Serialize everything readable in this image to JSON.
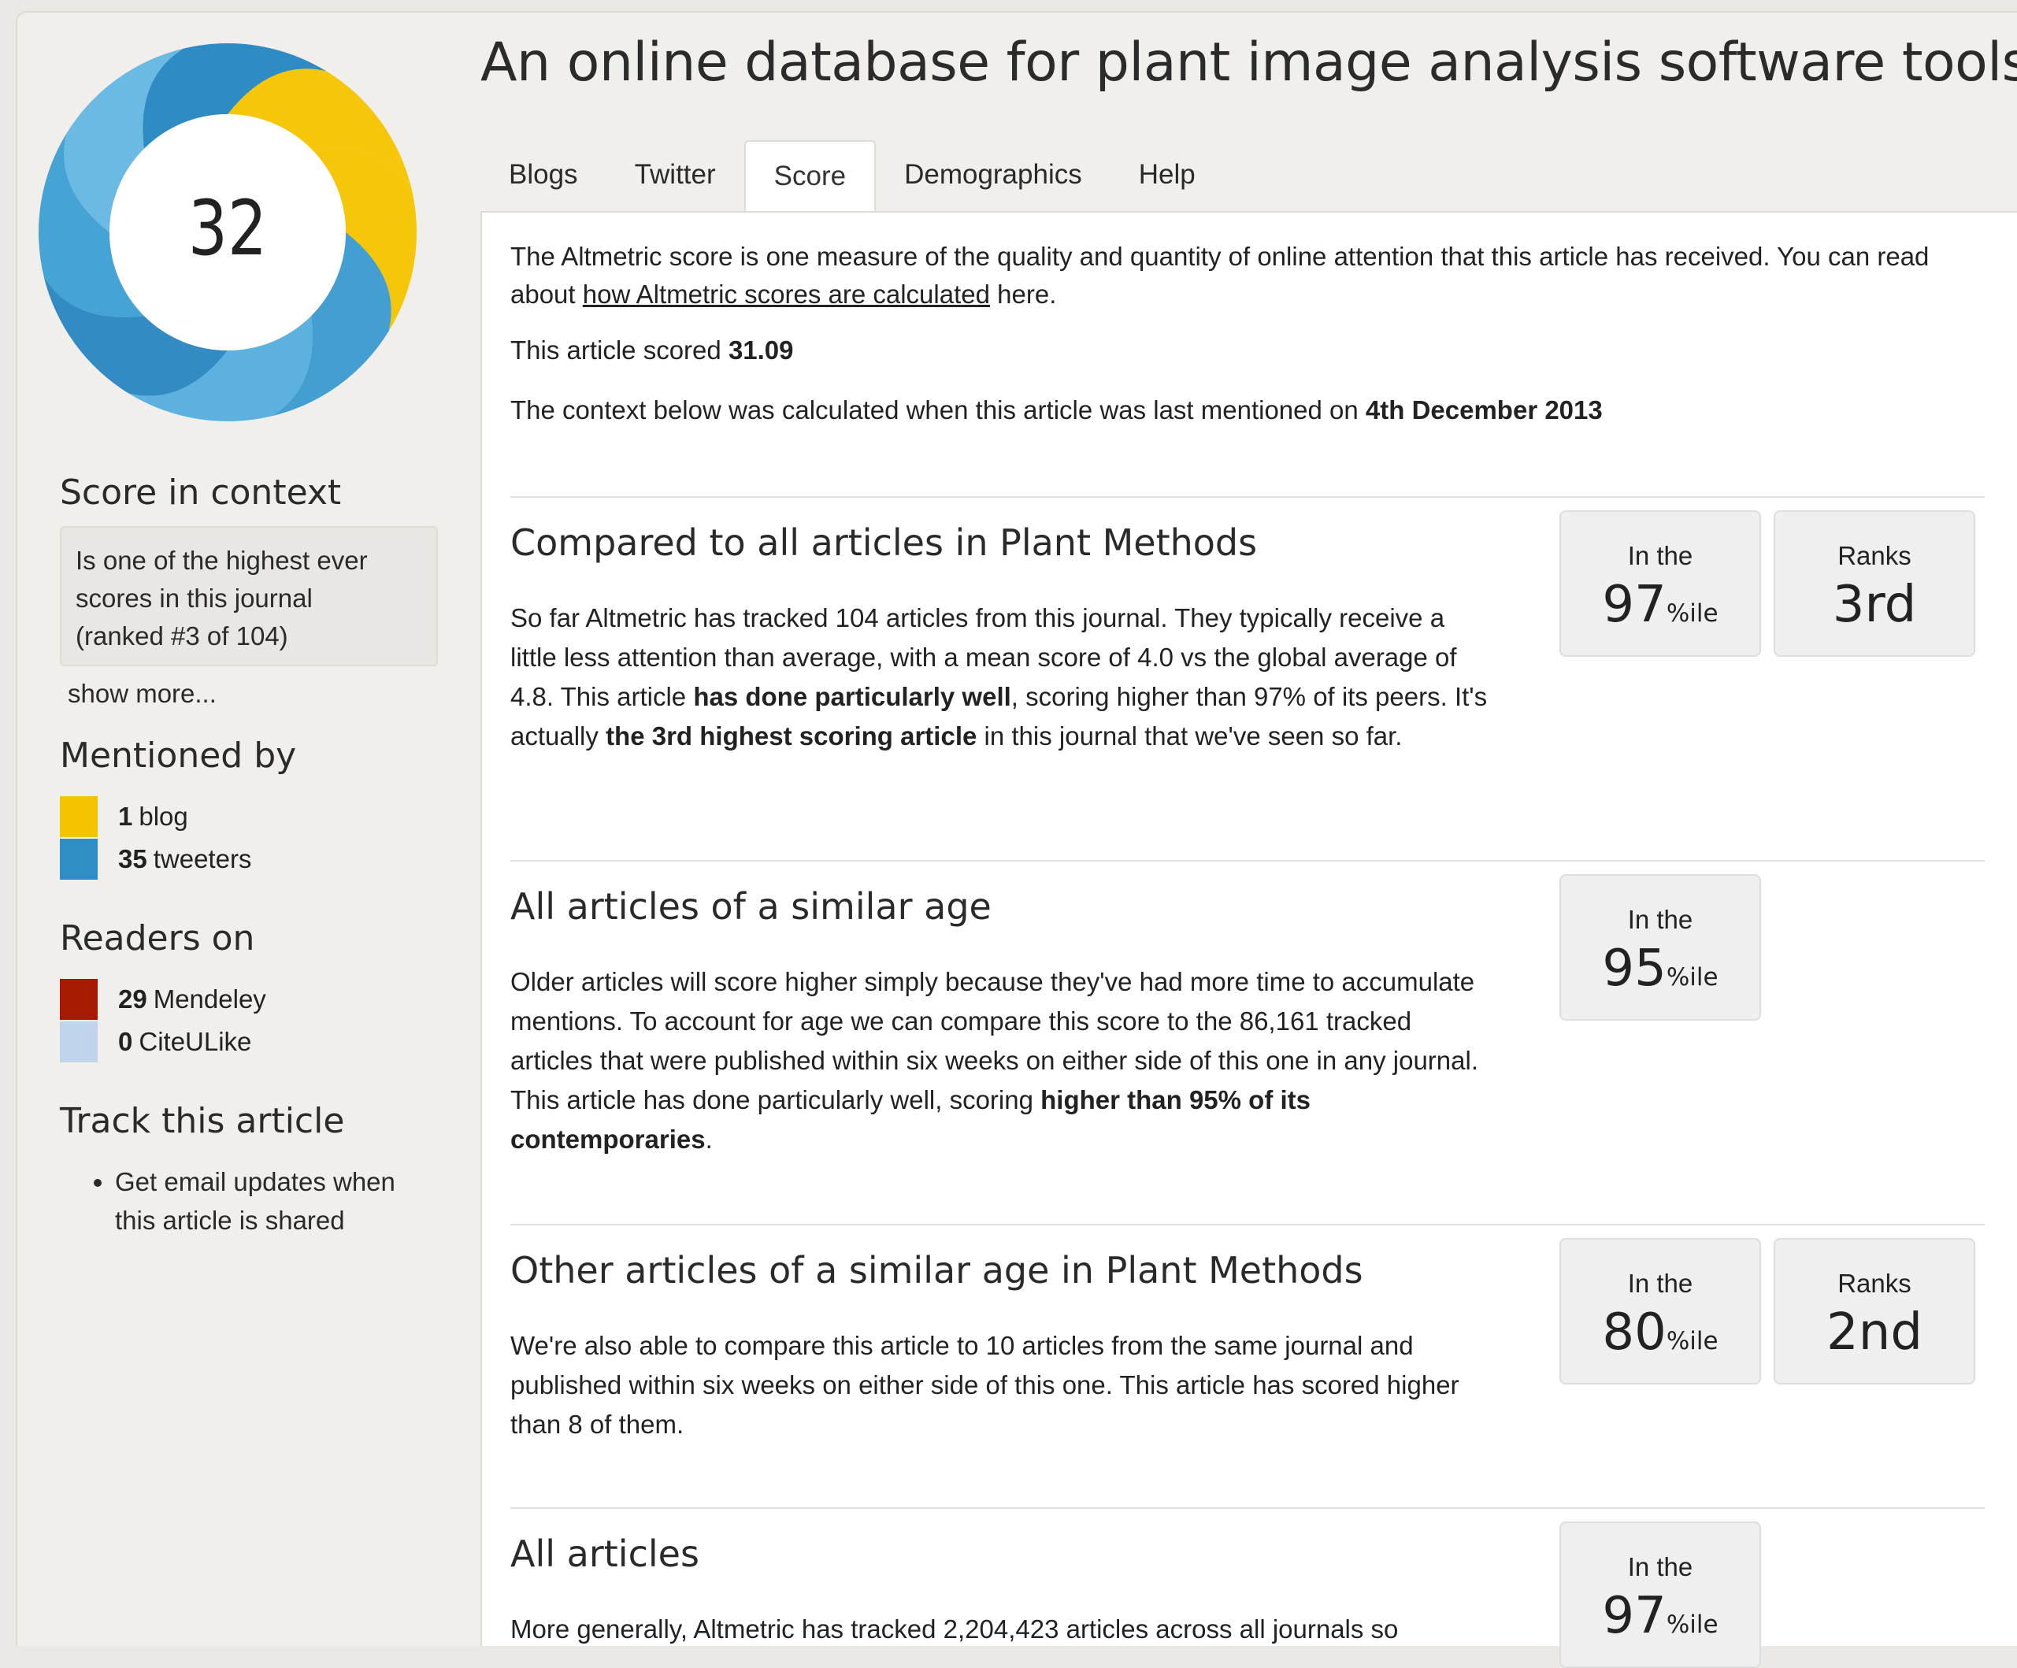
{
  "donut": {
    "score": "32",
    "colors": {
      "blog": "#f5c400",
      "twitter": "#2f8ec4"
    }
  },
  "article": {
    "title": "An online database for plant image analysis software tools"
  },
  "tabs": [
    "Blogs",
    "Twitter",
    "Score",
    "Demographics",
    "Help"
  ],
  "active_tab": "Score",
  "sidebar": {
    "score_context": {
      "heading": "Score in context",
      "box_lines": [
        "Is one of the highest ever",
        "scores in this journal",
        "(ranked #3 of 104)"
      ],
      "show_more": "show more..."
    },
    "mentioned_by": {
      "heading": "Mentioned by",
      "items": [
        {
          "count": "1",
          "label": "blog",
          "color": "#f5c400"
        },
        {
          "count": "35",
          "label": "tweeters",
          "color": "#2f8ec4"
        }
      ]
    },
    "readers_on": {
      "heading": "Readers on",
      "items": [
        {
          "count": "29",
          "label": "Mendeley",
          "color": "#a51a00"
        },
        {
          "count": "0",
          "label": "CiteULike",
          "color": "#c0d4ec"
        }
      ]
    },
    "track": {
      "heading": "Track this article",
      "items": [
        "Get email updates when this article is shared"
      ]
    }
  },
  "panel": {
    "intro_a": "The Altmetric score is one measure of the quality and quantity of online attention that this article has received. You can read about ",
    "intro_link": "how Altmetric scores are calculated",
    "intro_b": " here.",
    "scored_prefix": "This article scored ",
    "scored_value": "31.09",
    "context_prefix": "The context below was calculated when this article was last mentioned on ",
    "context_date": "4th December 2013",
    "sections": [
      {
        "heading": "Compared to all articles in Plant Methods",
        "text_parts": [
          {
            "t": "So far Altmetric has tracked 104 articles from this journal. They typically receive a little less attention than average, with a mean score of 4.0 vs the global average of 4.8. This article ",
            "b": false
          },
          {
            "t": "has done particularly well",
            "b": true
          },
          {
            "t": ", scoring higher than 97% of its peers. It's actually ",
            "b": false
          },
          {
            "t": "the 3rd highest scoring article",
            "b": true
          },
          {
            "t": " in this journal that we've seen so far.",
            "b": false
          }
        ],
        "percentile_label": "In the",
        "percentile": "97",
        "pct_suffix": "%ile",
        "rank_label": "Ranks",
        "rank": "3rd"
      },
      {
        "heading": "All articles of a similar age",
        "text_parts": [
          {
            "t": "Older articles will score higher simply because they've had more time to accumulate mentions. To account for age we can compare this score to the 86,161 tracked articles that were published within six weeks on either side of this one in any journal. This article has done particularly well, scoring ",
            "b": false
          },
          {
            "t": "higher than 95% of its contemporaries",
            "b": true
          },
          {
            "t": ".",
            "b": false
          }
        ],
        "percentile_label": "In the",
        "percentile": "95",
        "pct_suffix": "%ile"
      },
      {
        "heading": "Other articles of a similar age in Plant Methods",
        "text_parts": [
          {
            "t": "We're also able to compare this article to 10 articles from the same journal and published within six weeks on either side of this one. This article has scored higher than 8 of them.",
            "b": false
          }
        ],
        "percentile_label": "In the",
        "percentile": "80",
        "pct_suffix": "%ile",
        "rank_label": "Ranks",
        "rank": "2nd"
      },
      {
        "heading": "All articles",
        "text_parts": [
          {
            "t": "More generally, Altmetric has tracked 2,204,423 articles across all journals so",
            "b": false
          }
        ],
        "percentile_label": "In the",
        "percentile": "97",
        "pct_suffix": "%ile"
      }
    ]
  }
}
